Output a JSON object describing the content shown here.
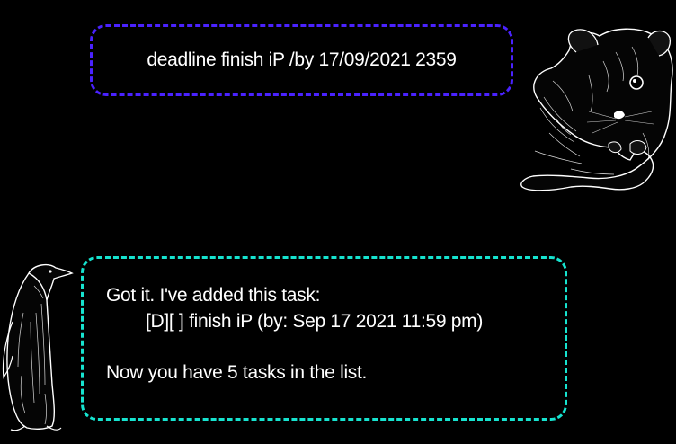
{
  "conversation": {
    "user_message": {
      "text": "deadline finish iP /by 17/09/2021 2359",
      "avatar": "hamster-icon"
    },
    "bot_message": {
      "line1": "Got it. I've added this task:",
      "line2": "[D][ ] finish iP (by: Sep 17 2021 11:59 pm)",
      "line3": "Now you have 5 tasks in the list.",
      "avatar": "penguin-icon"
    }
  },
  "colors": {
    "background": "#000000",
    "user_bubble_border": "#4a22ff",
    "bot_bubble_border": "#16e3cf",
    "text": "#ffffff"
  }
}
